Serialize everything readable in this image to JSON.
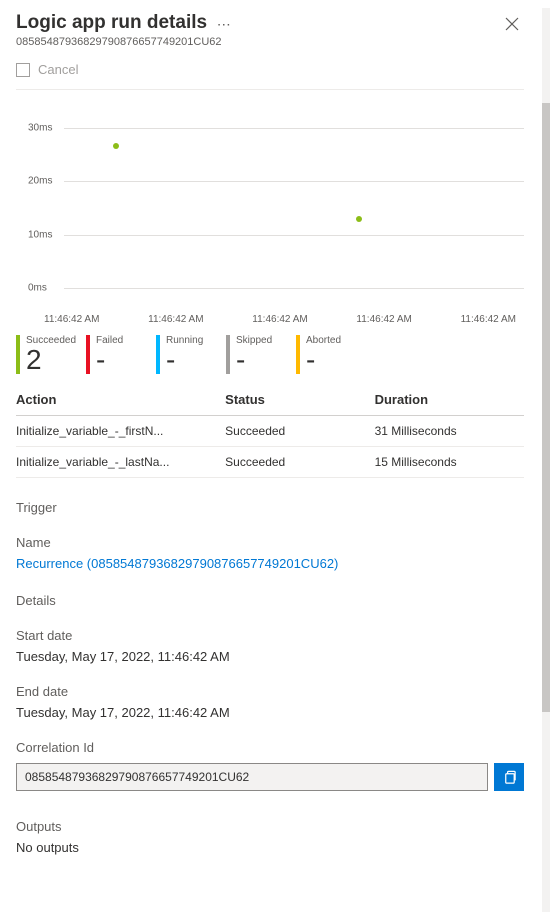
{
  "header": {
    "title": "Logic app run details",
    "run_id": "08585487936829790876657749201CU62"
  },
  "toolbar": {
    "cancel_label": "Cancel"
  },
  "chart_data": {
    "type": "scatter",
    "ylabel": "",
    "y_ticks": [
      "0ms",
      "10ms",
      "20ms",
      "30ms"
    ],
    "x_ticks": [
      "11:46:42 AM",
      "11:46:42 AM",
      "11:46:42 AM",
      "11:46:42 AM",
      "11:46:42 AM"
    ],
    "ylim": [
      0,
      35
    ],
    "series": [
      {
        "name": "run",
        "points": [
          {
            "x_index": 0.12,
            "y": 31
          },
          {
            "x_index": 0.72,
            "y": 15
          }
        ]
      }
    ]
  },
  "status_counts": [
    {
      "label": "Succeeded",
      "value": "2",
      "color": "#8CBD18"
    },
    {
      "label": "Failed",
      "value": "-",
      "color": "#E81123"
    },
    {
      "label": "Running",
      "value": "-",
      "color": "#00B7FF"
    },
    {
      "label": "Skipped",
      "value": "-",
      "color": "#A19F9D"
    },
    {
      "label": "Aborted",
      "value": "-",
      "color": "#FFB900"
    }
  ],
  "actions": {
    "columns": [
      "Action",
      "Status",
      "Duration"
    ],
    "rows": [
      {
        "action": "Initialize_variable_-_firstN...",
        "status": "Succeeded",
        "duration": "31 Milliseconds"
      },
      {
        "action": "Initialize_variable_-_lastNa...",
        "status": "Succeeded",
        "duration": "15 Milliseconds"
      }
    ]
  },
  "trigger": {
    "section": "Trigger",
    "name_label": "Name",
    "name_link": "Recurrence (08585487936829790876657749201CU62)"
  },
  "details": {
    "section": "Details",
    "start_label": "Start date",
    "start_value": "Tuesday, May 17, 2022, 11:46:42 AM",
    "end_label": "End date",
    "end_value": "Tuesday, May 17, 2022, 11:46:42 AM",
    "corr_label": "Correlation Id",
    "corr_value": "08585487936829790876657749201CU62"
  },
  "outputs": {
    "section": "Outputs",
    "value": "No outputs"
  }
}
